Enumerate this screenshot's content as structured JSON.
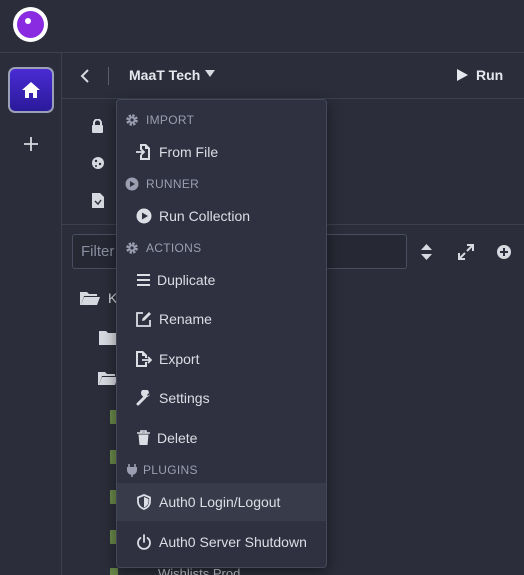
{
  "header": {
    "collection_name": "MaaT Tech",
    "run_label": "Run"
  },
  "filter": {
    "placeholder": "Filter"
  },
  "menu": {
    "sections": [
      {
        "label": "IMPORT",
        "icon": "gear-icon"
      },
      {
        "label": "RUNNER",
        "icon": "play-circle-icon"
      },
      {
        "label": "ACTIONS",
        "icon": "gear-icon"
      },
      {
        "label": "PLUGINS",
        "icon": "plug-icon"
      }
    ],
    "items": [
      {
        "label": "From File",
        "icon": "file-import-icon"
      },
      {
        "label": "Run Collection",
        "icon": "play-circle-icon"
      },
      {
        "label": "Duplicate",
        "icon": "lines-icon"
      },
      {
        "label": "Rename",
        "icon": "edit-icon"
      },
      {
        "label": "Export",
        "icon": "file-export-icon"
      },
      {
        "label": "Settings",
        "icon": "wrench-icon"
      },
      {
        "label": "Delete",
        "icon": "trash-icon"
      },
      {
        "label": "Auth0 Login/Logout",
        "icon": "shield-icon"
      },
      {
        "label": "Auth0 Server Shutdown",
        "icon": "power-icon"
      }
    ]
  },
  "tree": {
    "partial_root_letter": "K",
    "partial_bottom_text": "Wishlists Prod..."
  },
  "colors": {
    "accent": "#4a2bd4",
    "logo": "#8a2be2",
    "menu_bg": "#2f3140",
    "page_bg": "#2b2d3a"
  }
}
